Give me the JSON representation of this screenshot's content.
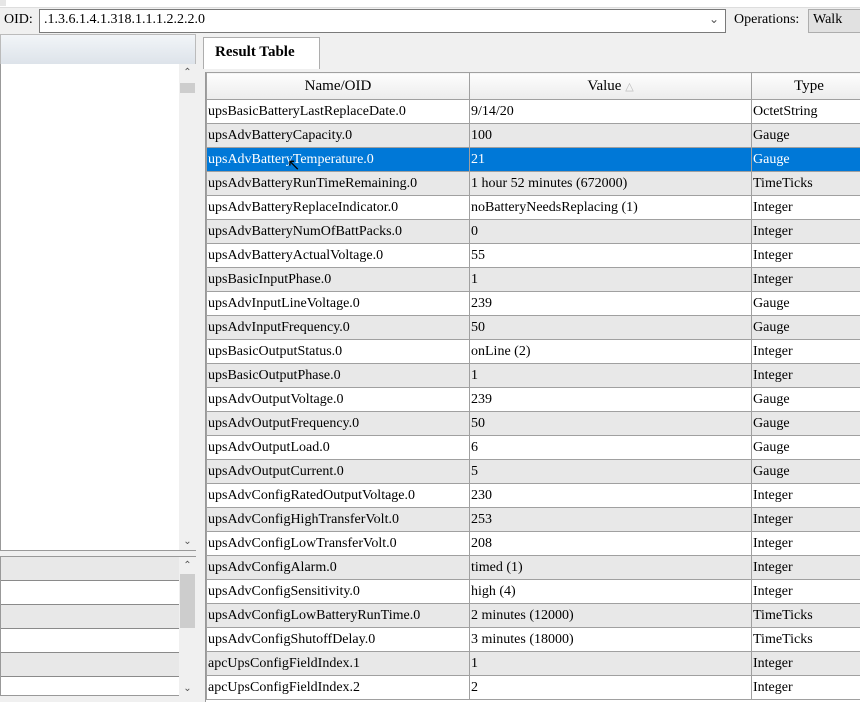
{
  "toolbar": {
    "oid_label": "OID:",
    "oid_value": ".1.3.6.1.4.1.318.1.1.1.2.2.2.0",
    "operations_label": "Operations:",
    "operations_value": "Walk"
  },
  "tab": {
    "label": "Result Table"
  },
  "table": {
    "columns": [
      "Name/OID",
      "Value",
      "Type"
    ],
    "sort_column": "Value",
    "selected_row": 2,
    "rows": [
      [
        "upsBasicBatteryLastReplaceDate.0",
        "9/14/20",
        "OctetString"
      ],
      [
        "upsAdvBatteryCapacity.0",
        "100",
        "Gauge"
      ],
      [
        "upsAdvBatteryTemperature.0",
        "21",
        "Gauge"
      ],
      [
        "upsAdvBatteryRunTimeRemaining.0",
        "1 hour 52 minutes  (672000)",
        "TimeTicks"
      ],
      [
        "upsAdvBatteryReplaceIndicator.0",
        "noBatteryNeedsReplacing (1)",
        "Integer"
      ],
      [
        "upsAdvBatteryNumOfBattPacks.0",
        "0",
        "Integer"
      ],
      [
        "upsAdvBatteryActualVoltage.0",
        "55",
        "Integer"
      ],
      [
        "upsBasicInputPhase.0",
        "1",
        "Integer"
      ],
      [
        "upsAdvInputLineVoltage.0",
        "239",
        "Gauge"
      ],
      [
        "upsAdvInputFrequency.0",
        "50",
        "Gauge"
      ],
      [
        "upsBasicOutputStatus.0",
        "onLine (2)",
        "Integer"
      ],
      [
        "upsBasicOutputPhase.0",
        "1",
        "Integer"
      ],
      [
        "upsAdvOutputVoltage.0",
        "239",
        "Gauge"
      ],
      [
        "upsAdvOutputFrequency.0",
        "50",
        "Gauge"
      ],
      [
        "upsAdvOutputLoad.0",
        "6",
        "Gauge"
      ],
      [
        "upsAdvOutputCurrent.0",
        "5",
        "Gauge"
      ],
      [
        "upsAdvConfigRatedOutputVoltage.0",
        "230",
        "Integer"
      ],
      [
        "upsAdvConfigHighTransferVolt.0",
        "253",
        "Integer"
      ],
      [
        "upsAdvConfigLowTransferVolt.0",
        "208",
        "Integer"
      ],
      [
        "upsAdvConfigAlarm.0",
        "timed (1)",
        "Integer"
      ],
      [
        "upsAdvConfigSensitivity.0",
        "high (4)",
        "Integer"
      ],
      [
        "upsAdvConfigLowBatteryRunTime.0",
        "2 minutes  (12000)",
        "TimeTicks"
      ],
      [
        "upsAdvConfigShutoffDelay.0",
        "3 minutes  (18000)",
        "TimeTicks"
      ],
      [
        "apcUpsConfigFieldIndex.1",
        "1",
        "Integer"
      ],
      [
        "apcUpsConfigFieldIndex.2",
        "2",
        "Integer"
      ]
    ]
  },
  "icons": {
    "dropdown": "chevron-down-icon",
    "sort": "sort-ascending-icon",
    "scroll_up": "chevron-up-icon",
    "scroll_down": "chevron-down-icon",
    "cursor": "mouse-pointer-icon"
  }
}
